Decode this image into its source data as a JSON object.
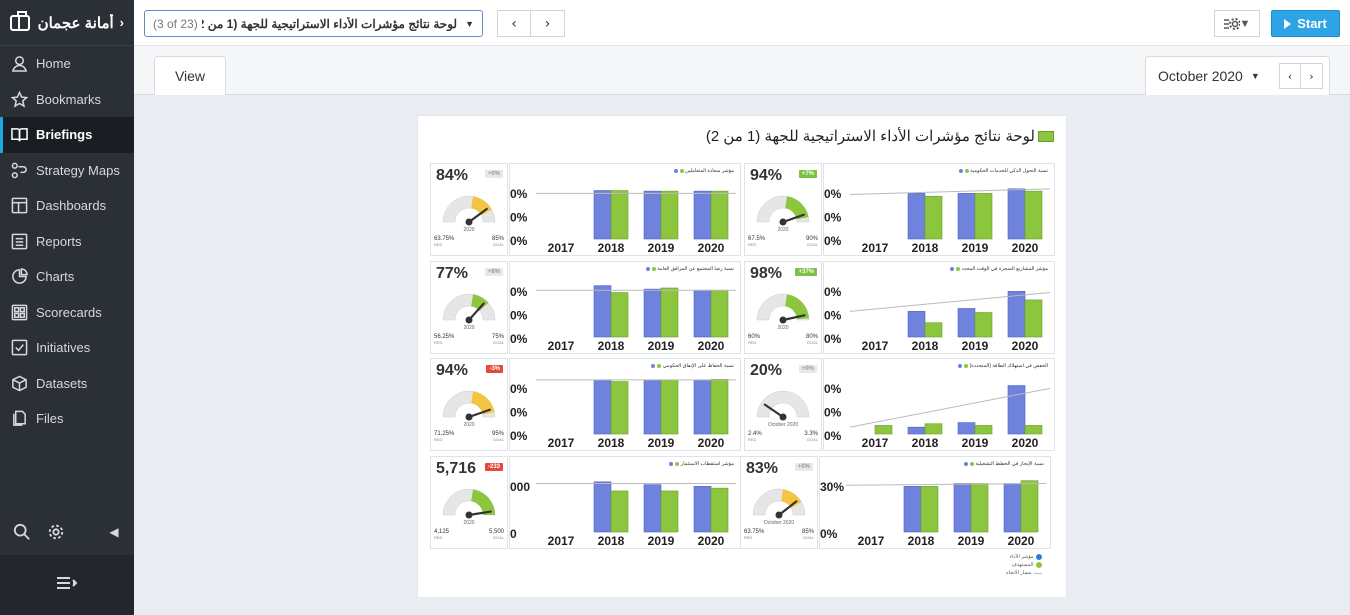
{
  "sidebar": {
    "brand": "أمانة عجمان",
    "items": [
      {
        "label": "Home",
        "icon": "user-icon"
      },
      {
        "label": "Bookmarks",
        "icon": "star-icon"
      },
      {
        "label": "Briefings",
        "icon": "book-icon",
        "active": true
      },
      {
        "label": "Strategy Maps",
        "icon": "strategy-map-icon"
      },
      {
        "label": "Dashboards",
        "icon": "dashboard-icon"
      },
      {
        "label": "Reports",
        "icon": "report-icon"
      },
      {
        "label": "Charts",
        "icon": "pie-chart-icon"
      },
      {
        "label": "Scorecards",
        "icon": "scorecard-icon"
      },
      {
        "label": "Initiatives",
        "icon": "checkbox-icon"
      },
      {
        "label": "Datasets",
        "icon": "cube-icon"
      },
      {
        "label": "Files",
        "icon": "files-icon"
      }
    ]
  },
  "topbar": {
    "count": "(3 of 23)",
    "briefing_title": "لوحة نتائج مؤشرات الأداء الاستراتيجية للجهة (1 من 2)",
    "prev": "‹",
    "next": "›",
    "start_label": "Start"
  },
  "tabs": {
    "view_label": "View",
    "period": "October 2020"
  },
  "page": {
    "title": "لوحة نتائج مؤشرات الأداء الاستراتيجية للجهة (1 من 2)",
    "kpis": [
      {
        "pct": "84%",
        "badge": "+0%",
        "badge_color": "#e8e8e8",
        "period": "2020",
        "red": "63.75%",
        "goal": "85%",
        "level": 0.84,
        "color": "#f5c542"
      },
      {
        "pct": "77%",
        "badge": "+8%",
        "badge_color": "#e8e8e8",
        "period": "2020",
        "red": "56.25%",
        "goal": "75%",
        "level": 0.77,
        "color": "#8cc63f"
      },
      {
        "pct": "94%",
        "badge": "-3%",
        "badge_color": "#e24b3b",
        "period": "2020",
        "red": "71.25%",
        "goal": "95%",
        "level": 0.94,
        "color": "#f5c542"
      },
      {
        "pct": "5,716",
        "badge": "-233",
        "badge_color": "#e24b3b",
        "period": "2020",
        "red": "4,125",
        "goal": "5,500",
        "level": 1.04,
        "color": "#8cc63f"
      },
      {
        "pct": "94%",
        "badge": "+7%",
        "badge_color": "#7bc142",
        "period": "2020",
        "red": "67.5%",
        "goal": "90%",
        "level": 0.94,
        "color": "#8cc63f"
      },
      {
        "pct": "98%",
        "badge": "+37%",
        "badge_color": "#7bc142",
        "period": "2020",
        "red": "60%",
        "goal": "80%",
        "level": 0.98,
        "color": "#8cc63f"
      },
      {
        "pct": "20%",
        "badge": "+0%",
        "badge_color": "#e8e8e8",
        "period": "October 2020",
        "red": "2.4%",
        "goal": "3.3%",
        "level": 0.2,
        "color": "#8cc63f"
      },
      {
        "pct": "83%",
        "badge": "+0%",
        "badge_color": "#e8e8e8",
        "period": "October 2020",
        "red": "63.75%",
        "goal": "85%",
        "level": 0.83,
        "color": "#f5c542"
      }
    ],
    "charts": [
      {
        "title": "مؤشر سعادة المتعاملين",
        "ylabels": [
          "0%",
          "0%",
          "0%"
        ],
        "years": [
          "2017",
          "2018",
          "2019",
          "2020"
        ],
        "actual": [
          0,
          0.85,
          0.84,
          0.84
        ],
        "target": [
          0,
          0.85,
          0.84,
          0.84
        ],
        "trend": [
          0.8,
          0.8
        ]
      },
      {
        "title": "نسبة رضا المجتمع عن المرافق العامة",
        "ylabels": [
          "0%",
          "0%",
          "0%"
        ],
        "years": [
          "2017",
          "2018",
          "2019",
          "2020"
        ],
        "actual": [
          0,
          0.9,
          0.84,
          0.82
        ],
        "target": [
          0,
          0.78,
          0.86,
          0.82
        ],
        "trend": [
          0.82,
          0.82
        ]
      },
      {
        "title": "نسبة الحفاظ على الإنفاق الحكومي",
        "ylabels": [
          "0%",
          "0%",
          "0%"
        ],
        "years": [
          "2017",
          "2018",
          "2019",
          "2020"
        ],
        "actual": [
          0,
          0.95,
          0.95,
          0.95
        ],
        "target": [
          0,
          0.92,
          0.95,
          0.96
        ],
        "trend": [
          0.95,
          0.95
        ]
      },
      {
        "title": "مؤشر استقطاب الاستثمار",
        "ylabels": [
          "000",
          "0"
        ],
        "years": [
          "2017",
          "2018",
          "2019",
          "2020"
        ],
        "actual": [
          0,
          0.88,
          0.83,
          0.8
        ],
        "target": [
          0,
          0.72,
          0.72,
          0.77
        ],
        "trend": [
          0.85,
          0.85
        ]
      },
      {
        "title": "نسبة التحول الذكي للخدمات الحكومية",
        "ylabels": [
          "0%",
          "0%",
          "0%"
        ],
        "years": [
          "2017",
          "2018",
          "2019",
          "2020"
        ],
        "actual": [
          0,
          0.8,
          0.8,
          0.88
        ],
        "target": [
          0,
          0.75,
          0.8,
          0.84
        ],
        "trend": [
          0.78,
          0.88
        ]
      },
      {
        "title": "مؤشر المشاريع المنجزة في الوقت المحدد",
        "ylabels": [
          "0%",
          "0%",
          "0%"
        ],
        "years": [
          "2017",
          "2018",
          "2019",
          "2020"
        ],
        "actual": [
          0,
          0.45,
          0.5,
          0.8
        ],
        "target": [
          0,
          0.25,
          0.43,
          0.65
        ],
        "trend": [
          0.45,
          0.78
        ]
      },
      {
        "title": "الخفض في استهلاك الطاقة (المتجددة)",
        "ylabels": [
          "0%",
          "0%",
          "0%"
        ],
        "years": [
          "2017",
          "2018",
          "2019",
          "2020"
        ],
        "actual": [
          0,
          0.12,
          0.2,
          0.85
        ],
        "target": [
          0.15,
          0.18,
          0.15,
          0.15
        ],
        "trend": [
          0.12,
          0.8
        ]
      },
      {
        "title": "نسبة الإنجاز في الخطط التشغيلية",
        "ylabels": [
          "30%",
          "0%"
        ],
        "years": [
          "2017",
          "2018",
          "2019",
          "2020"
        ],
        "actual": [
          0,
          0.8,
          0.85,
          0.85
        ],
        "target": [
          0,
          0.8,
          0.85,
          0.9
        ],
        "trend": [
          0.82,
          0.85
        ]
      }
    ],
    "legend": {
      "actual": "مؤشر الأداء",
      "target": "المستهدف",
      "trend": "مسار الاتجاه"
    },
    "colors": {
      "actual": "#6f82dc",
      "target": "#8cc63f",
      "trend": "#bbbbbb"
    }
  }
}
